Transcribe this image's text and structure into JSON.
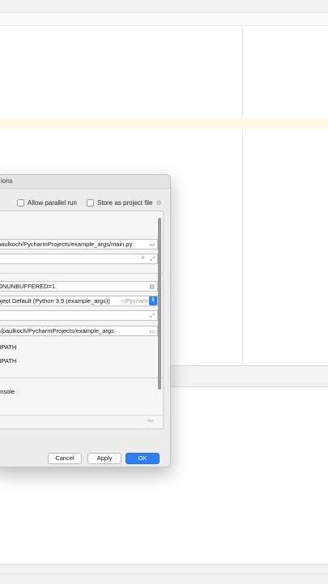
{
  "dialog": {
    "title": "ions",
    "allow_parallel_label": "Allow parallel run",
    "store_project_label": "Store as project file",
    "script_path": "paulkoch/PycharmProjects/example_args/main.py",
    "env_vars": "ONUNBUFFERED=1",
    "interpreter": "oject Default (Python 3.9 (example_args))",
    "interpreter_hint": "~/PycharmP",
    "working_dir": "s/paulkoch/PycharmProjects/example_args",
    "content_roots_label": "NPATH",
    "source_roots_label": "NPATH",
    "console_label": "onsole",
    "buttons": {
      "cancel": "Cancel",
      "apply": "Apply",
      "ok": "OK"
    }
  },
  "icons": {
    "folder": "folder-icon",
    "gear": "gear-icon",
    "expand": "expand-icon",
    "plus": "plus-icon",
    "dropdown": "dropdown-arrow-icon",
    "list": "list-icon"
  },
  "colors": {
    "primary": "#2f7ff0",
    "highlight": "#fdf9e6"
  }
}
